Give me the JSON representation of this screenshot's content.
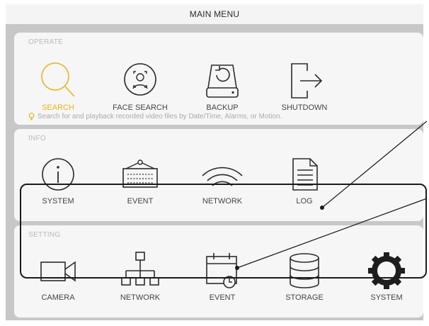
{
  "title": "MAIN MENU",
  "operate": {
    "label": "OPERATE",
    "items": [
      {
        "label": "SEARCH",
        "icon": "search-icon",
        "active": true
      },
      {
        "label": "FACE SEARCH",
        "icon": "face-search-icon"
      },
      {
        "label": "BACKUP",
        "icon": "backup-icon"
      },
      {
        "label": "SHUTDOWN",
        "icon": "shutdown-icon"
      }
    ],
    "hint": "Search for and playback recorded video files by Date/Time, Alarms, or Motion."
  },
  "info": {
    "label": "INFO",
    "items": [
      {
        "label": "SYSTEM",
        "icon": "info-icon"
      },
      {
        "label": "EVENT",
        "icon": "event-panel-icon"
      },
      {
        "label": "NETWORK",
        "icon": "wifi-icon"
      },
      {
        "label": "LOG",
        "icon": "log-document-icon"
      }
    ]
  },
  "setting": {
    "label": "SETTING",
    "items": [
      {
        "label": "CAMERA",
        "icon": "camera-icon"
      },
      {
        "label": "NETWORK",
        "icon": "network-tree-icon"
      },
      {
        "label": "EVENT",
        "icon": "calendar-clock-icon"
      },
      {
        "label": "STORAGE",
        "icon": "database-icon"
      },
      {
        "label": "SYSTEM",
        "icon": "gear-icon"
      }
    ]
  },
  "colors": {
    "accent": "#e8b321",
    "icon": "#2b2b2b",
    "frame": "#c7c7c7",
    "panel": "#f6f6f6"
  }
}
